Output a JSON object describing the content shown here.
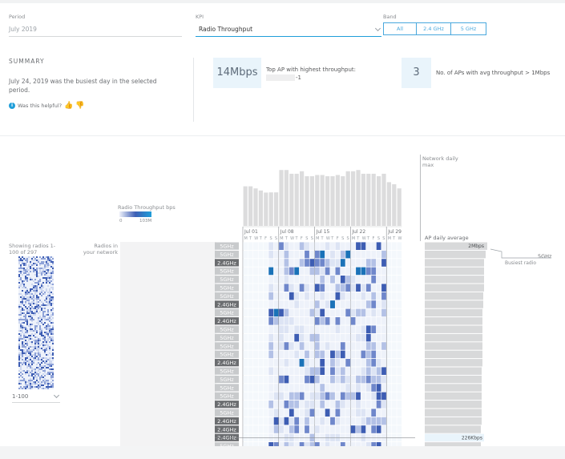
{
  "filters": {
    "period_label": "Period",
    "period_value": "July 2019",
    "kpi_label": "KPI",
    "kpi_value": "Radio Throughput",
    "band_label": "Band",
    "band_options": [
      "All",
      "2.4 GHz",
      "5 GHz"
    ]
  },
  "summary": {
    "title": "SUMMARY",
    "text": "July 24, 2019 was the busiest day in the selected period.",
    "helpful": "Was this helpful?"
  },
  "metrics": [
    {
      "value": "14Mbps",
      "text": "Top AP with highest throughput:",
      "sub": "-1"
    },
    {
      "value": "3",
      "text": "No. of APs with avg throughput > 1Mbps"
    }
  ],
  "chart": {
    "network_label": "Network daily max",
    "legend_title": "Radio Throughput bps",
    "legend_min": "0",
    "legend_max": "103M",
    "week_labels": [
      "Jul 01",
      "Jul 08",
      "Jul 15",
      "Jul 22",
      "Jul 29"
    ],
    "day_letters": [
      "M",
      "T",
      "W",
      "T",
      "F",
      "S",
      "S",
      "M",
      "T",
      "W",
      "T",
      "F",
      "S",
      "S",
      "M",
      "T",
      "W",
      "T",
      "F",
      "S",
      "S",
      "M",
      "T",
      "W",
      "T",
      "F",
      "S",
      "S",
      "M",
      "T",
      "W"
    ],
    "radios_label": "Radios in your network",
    "showing_label": "Showing radios 1-100 of 297",
    "pager_value": "1-100",
    "ap_avg_label": "AP daily average",
    "busiest_value": "2Mbps",
    "busiest_band": "5GHz",
    "busiest_label": "Busiest radio",
    "hover_value": "226Kbps",
    "bands": [
      "5GHz",
      "5GHz",
      "2.4GHz",
      "5GHz",
      "5GHz",
      "5GHz",
      "5GHz",
      "2.4GHz",
      "5GHz",
      "2.4GHz",
      "5GHz",
      "5GHz",
      "5GHz",
      "5GHz",
      "2.4GHz",
      "5GHz",
      "5GHz",
      "5GHz",
      "5GHz",
      "2.4GHz",
      "5GHz",
      "2.4GHz",
      "2.4GHz",
      "2.4GHz",
      "5GHz",
      "2.4GHz",
      "2.4GHz"
    ],
    "colors": {
      "accent": "#1f9ed9",
      "band_dark": "#6b6d70",
      "band_light": "#c8cacc",
      "cell_max": "#1a72b8"
    }
  }
}
